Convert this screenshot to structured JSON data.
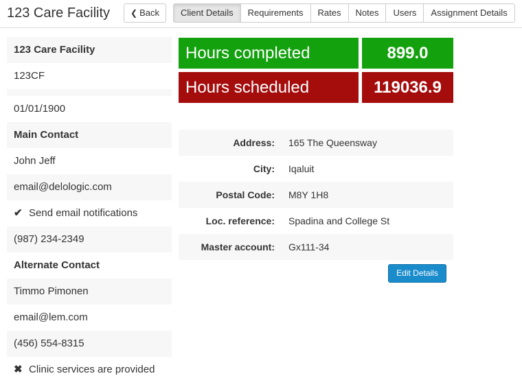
{
  "header": {
    "title": "123 Care Facility",
    "back_label": "Back",
    "tabs": [
      "Client Details",
      "Requirements",
      "Rates",
      "Notes",
      "Users",
      "Assignment Details"
    ]
  },
  "left": {
    "name": "123 Care Facility",
    "code": "123CF",
    "date": "01/01/1900",
    "main_contact_heading": "Main Contact",
    "main_contact_name": "John Jeff",
    "main_contact_email": "email@delologic.com",
    "send_email_label": "Send email notifications",
    "main_contact_phone": "(987) 234-2349",
    "alternate_contact_heading": "Alternate Contact",
    "alternate_contact_name": "Timmo Pimonen",
    "alternate_contact_email": "email@lem.com",
    "alternate_contact_phone": "(456) 554-8315",
    "clinic_services_label": "Clinic services are provided"
  },
  "stats": {
    "hours_completed_label": "Hours completed",
    "hours_completed_value": "899.0",
    "hours_scheduled_label": "Hours scheduled",
    "hours_scheduled_value": "119036.9"
  },
  "details": {
    "address_label": "Address:",
    "address_value": "165 The Queensway",
    "city_label": "City:",
    "city_value": "Iqaluit",
    "postal_label": "Postal Code:",
    "postal_value": "M8Y 1H8",
    "locref_label": "Loc. reference:",
    "locref_value": "Spadina and College St",
    "master_label": "Master account:",
    "master_value": "Gx111-34"
  },
  "edit_button_label": "Edit Details",
  "colors": {
    "completed": "#13a10e",
    "scheduled": "#a50c0c",
    "accent": "#1a8ccc"
  },
  "icons": {
    "back": "chevron-left-icon",
    "send_email": "check-icon",
    "clinic_services": "x-icon"
  }
}
